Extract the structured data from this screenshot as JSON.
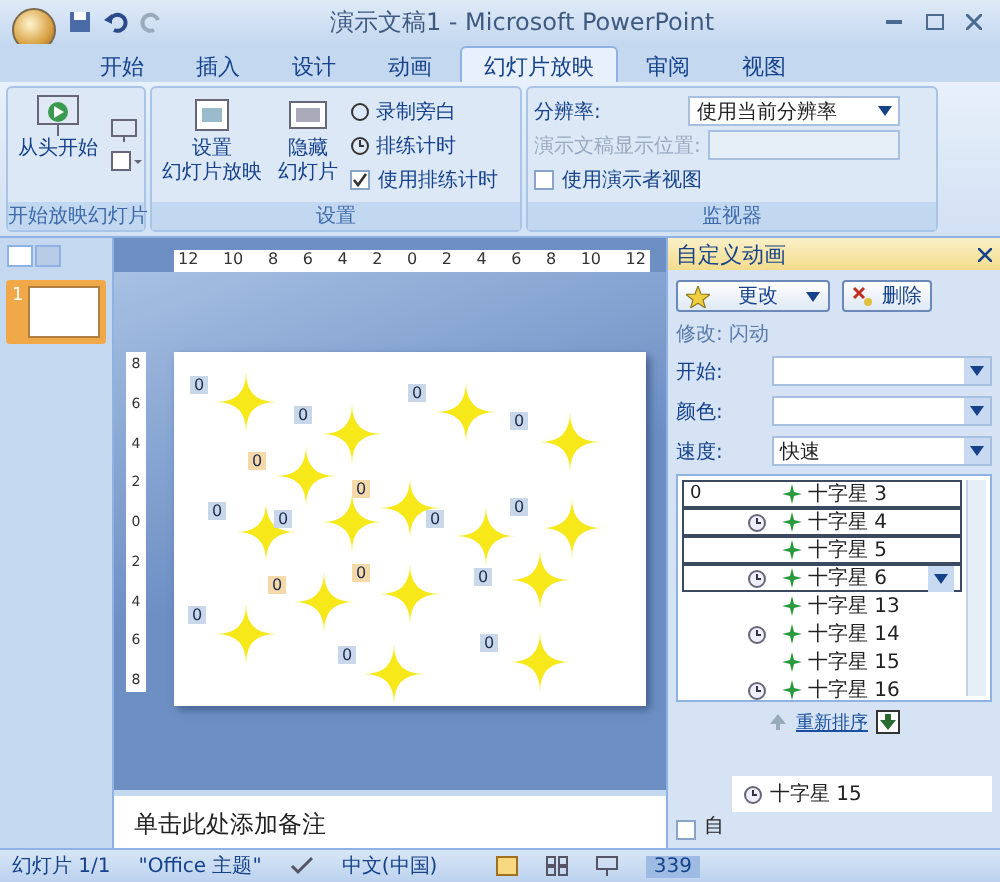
{
  "window": {
    "title": "演示文稿1 - Microsoft PowerPoint"
  },
  "tabs": [
    {
      "label": "开始",
      "selected": false
    },
    {
      "label": "插入",
      "selected": false
    },
    {
      "label": "设计",
      "selected": false
    },
    {
      "label": "动画",
      "selected": false
    },
    {
      "label": "幻灯片放映",
      "selected": true
    },
    {
      "label": "审阅",
      "selected": false
    },
    {
      "label": "视图",
      "selected": false
    }
  ],
  "ribbon": {
    "start_group": {
      "title": "开始放映幻灯片",
      "from_beginning": "从头开始"
    },
    "setup_group": {
      "title": "设置",
      "setup_show": [
        "设置",
        "幻灯片放映"
      ],
      "hide_slide": [
        "隐藏",
        "幻灯片"
      ],
      "record": "录制旁白",
      "rehearse": "排练计时",
      "use_timings": {
        "label": "使用排练计时",
        "checked": true
      }
    },
    "monitors_group": {
      "title": "监视器",
      "resolution": {
        "label": "分辨率:",
        "value": "使用当前分辨率"
      },
      "show_on": {
        "label": "演示文稿显示位置:",
        "disabled": true
      },
      "presenter_view": {
        "label": "使用演示者视图",
        "checked": false
      }
    }
  },
  "slide_pane": {
    "thumbnails": [
      {
        "number": "1",
        "selected": true
      }
    ]
  },
  "ruler": {
    "horizontal": [
      "12",
      "10",
      "8",
      "6",
      "4",
      "2",
      "0",
      "2",
      "4",
      "6",
      "8",
      "10",
      "12"
    ],
    "vertical": [
      "8",
      "6",
      "4",
      "2",
      "0",
      "2",
      "4",
      "6",
      "8"
    ]
  },
  "slide": {
    "labels": [
      {
        "text": "0",
        "color": "#c9d7ea"
      },
      {
        "text": "0",
        "color": "#c9d7ea"
      },
      {
        "text": "0",
        "color": "#c9d7ea"
      },
      {
        "text": "0",
        "color": "#c9d7ea"
      },
      {
        "text": "0",
        "color": "#f5d9a8"
      },
      {
        "text": "0",
        "color": "#c9d7ea"
      },
      {
        "text": "0",
        "color": "#f5d9a8"
      },
      {
        "text": "0",
        "color": "#c9d7ea"
      },
      {
        "text": "0",
        "color": "#c9d7ea"
      },
      {
        "text": "0",
        "color": "#c9d7ea"
      },
      {
        "text": "0",
        "color": "#c9d7ea"
      },
      {
        "text": "0",
        "color": "#f5d9a8"
      },
      {
        "text": "0",
        "color": "#f5d9a8"
      },
      {
        "text": "0",
        "color": "#c9d7ea"
      },
      {
        "text": "0",
        "color": "#c9d7ea"
      },
      {
        "text": "0",
        "color": "#c9d7ea"
      }
    ]
  },
  "notes": {
    "text": "单击此处添加备注"
  },
  "task_pane": {
    "title": "自定义动画",
    "change_button": "更改",
    "remove_button": "删除",
    "modify": "修改: 闪动",
    "fields": [
      {
        "label": "开始:"
      },
      {
        "label": "颜色:"
      },
      {
        "label": "速度:",
        "value": "快速"
      }
    ],
    "animations": [
      {
        "order": "0",
        "timed": false,
        "name": "十字星 3",
        "selected": true,
        "menu": false
      },
      {
        "timed": true,
        "name": "十字星 4",
        "selected": true,
        "menu": false
      },
      {
        "timed": false,
        "name": "十字星 5",
        "selected": true,
        "menu": false
      },
      {
        "timed": true,
        "name": "十字星 6",
        "selected": true,
        "menu": true
      },
      {
        "timed": false,
        "name": "十字星 13",
        "selected": false,
        "menu": false
      },
      {
        "timed": true,
        "name": "十字星 14",
        "selected": false,
        "menu": false
      },
      {
        "timed": false,
        "name": "十字星 15",
        "selected": false,
        "menu": false
      },
      {
        "timed": true,
        "name": "十字星 16",
        "selected": false,
        "menu": false
      }
    ],
    "reorder": "重新排序",
    "drag_ghost": [
      {
        "timed": true,
        "name": "十字星 15"
      }
    ],
    "autopreview": {
      "label": "自",
      "checked": false
    }
  },
  "status_bar": {
    "slide": "幻灯片 1/1",
    "theme": "\"Office 主题\"",
    "language": "中文(中国)",
    "zoom": "339"
  }
}
